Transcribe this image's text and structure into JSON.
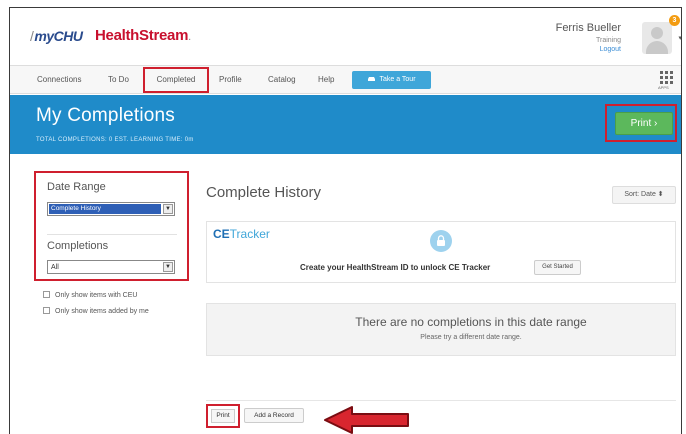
{
  "header": {
    "logo_slash": "/",
    "logo_my": "myCHU",
    "logo_brand": "HealthStream",
    "logo_dot": ".",
    "user_name": "Ferris Bueller",
    "user_role": "Training",
    "logout": "Logout",
    "notification_count": "3"
  },
  "nav": {
    "items": [
      "Connections",
      "To Do",
      "Completed",
      "Profile",
      "Catalog",
      "Help"
    ],
    "tour": "Take a Tour",
    "apps": "APPS"
  },
  "banner": {
    "title": "My Completions",
    "stats": "TOTAL COMPLETIONS: 0   EST. LEARNING TIME: 0m",
    "print": "Print ›"
  },
  "sidebar": {
    "date_range_label": "Date Range",
    "date_range_value": "Complete History",
    "completions_label": "Completions",
    "completions_value": "All",
    "check1": "Only show items with CEU",
    "check2": "Only show items added by me"
  },
  "main": {
    "title": "Complete History",
    "sort": "Sort: Date ⬍",
    "ce_brand_bold": "CE",
    "ce_brand_light": "Tracker",
    "ce_text": "Create your HealthStream ID to unlock CE Tracker",
    "ce_button": "Get Started",
    "empty_title": "There are no completions in this date range",
    "empty_sub": "Please try a different date range.",
    "print_bottom": "Print",
    "add_record": "Add a Record"
  },
  "colors": {
    "banner": "#1f8bc9",
    "highlight": "#cf1f2e",
    "print_green": "#5cb85c",
    "brand_red": "#c8102e"
  }
}
